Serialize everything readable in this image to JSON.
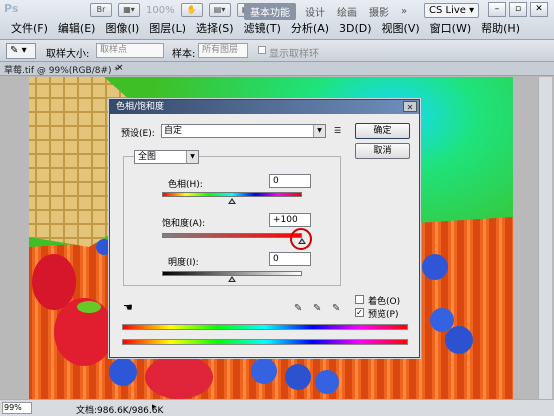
{
  "app": {
    "logo": "Ps"
  },
  "menu": [
    "文件(F)",
    "编辑(E)",
    "图像(I)",
    "图层(L)",
    "选择(S)",
    "滤镜(T)",
    "分析(A)",
    "3D(D)",
    "视图(V)",
    "窗口(W)",
    "帮助(H)"
  ],
  "toolbar": {
    "zoom": "100%"
  },
  "workspace": {
    "active": "基本功能",
    "items": [
      "设计",
      "绘画",
      "摄影"
    ],
    "more": "»",
    "cslive": "CS Live"
  },
  "window_controls": [
    "minimize-icon",
    "restore-icon",
    "close-icon"
  ],
  "options_bar": {
    "sample_size_label": "取样大小:",
    "sample_size_value": "取样点",
    "sample_label": "样本:",
    "sample_value": "所有图层",
    "show_ring_label": "显示取样环"
  },
  "document": {
    "tab": "草莓.tif @ 99%(RGB/8#) *",
    "close": "×"
  },
  "status": {
    "zoom": "99%",
    "size": "文档:986.6K/986.6K"
  },
  "dialog": {
    "title": "色相/饱和度",
    "preset_label": "预设(E):",
    "preset_value": "自定",
    "ok": "确定",
    "cancel": "取消",
    "channel": "全图",
    "hue_label": "色相(H):",
    "hue_value": "0",
    "saturation_label": "饱和度(A):",
    "saturation_value": "+100",
    "lightness_label": "明度(I):",
    "lightness_value": "0",
    "colorize_label": "着色(O)",
    "colorize_checked": false,
    "preview_label": "预览(P)",
    "preview_checked": true,
    "hue_fraction": 0.5,
    "saturation_fraction": 1.0,
    "lightness_fraction": 0.5
  },
  "colors": {
    "title_bar": "#35496a",
    "highlight_ring": "#d00000"
  }
}
